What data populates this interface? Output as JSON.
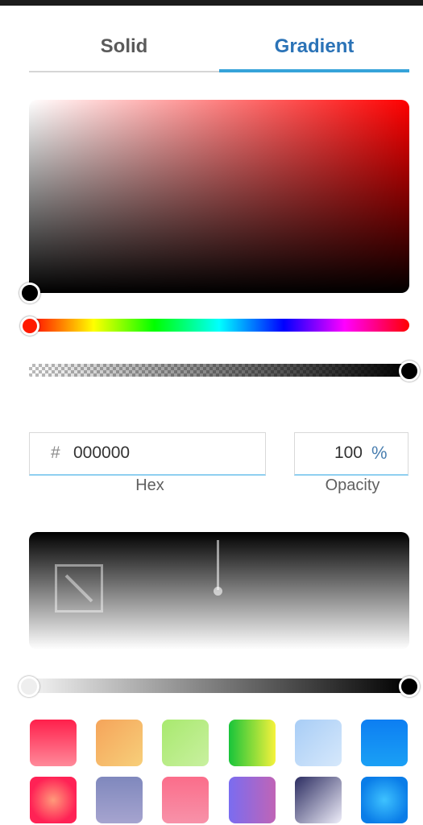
{
  "tabs": {
    "solid_label": "Solid",
    "gradient_label": "Gradient",
    "active": "Gradient"
  },
  "color_picker": {
    "hue_color": "#ff0000",
    "hue_value": 0,
    "saturation": 0,
    "brightness": 0
  },
  "alpha_slider": {
    "value": 1.0
  },
  "hex_field": {
    "prefix": "#",
    "value": "000000",
    "label": "Hex"
  },
  "opacity_field": {
    "value": "100",
    "unit": "%",
    "label": "Opacity"
  },
  "gradient_preview": {
    "start_color": "#000000",
    "end_color": "#ffffff",
    "stops": [
      {
        "color": "#f4f4f4",
        "offset": 0
      },
      {
        "color": "#000000",
        "offset": 1
      }
    ]
  },
  "colors": {
    "accent": "#2b73b7",
    "active_underline": "#36a3d9"
  },
  "swatches": [
    {
      "name": "swatch-1",
      "gradient": "linear-gradient(to bottom, #ff1f4b, #ff8a9a)"
    },
    {
      "name": "swatch-2",
      "gradient": "linear-gradient(to bottom right, #f5a45a, #f7cf7a)"
    },
    {
      "name": "swatch-3",
      "gradient": "linear-gradient(to bottom right, #a8e96e, #c9f0a0)"
    },
    {
      "name": "swatch-4",
      "gradient": "linear-gradient(to right, #18c43a, #f6f23b)"
    },
    {
      "name": "swatch-5",
      "gradient": "linear-gradient(to bottom right, #a8cdf6, #d6e8fb)"
    },
    {
      "name": "swatch-6",
      "gradient": "linear-gradient(to bottom, #0d7ef2, #1aa0f5)"
    },
    {
      "name": "swatch-7",
      "gradient": "radial-gradient(circle, #ff9a7a 0%, #ff2255 70%)"
    },
    {
      "name": "swatch-8",
      "gradient": "linear-gradient(to bottom, #7f88bd, #a6a4cf)"
    },
    {
      "name": "swatch-9",
      "gradient": "linear-gradient(to bottom, #fb6d8a, #f792a9)"
    },
    {
      "name": "swatch-10",
      "gradient": "linear-gradient(to right, #7a6cf0, #c064b6)"
    },
    {
      "name": "swatch-11",
      "gradient": "linear-gradient(to bottom right, #2c2d61, #efeefa)"
    },
    {
      "name": "swatch-12",
      "gradient": "radial-gradient(circle, #3ec2ff 0%, #0a7de8 75%)"
    }
  ]
}
